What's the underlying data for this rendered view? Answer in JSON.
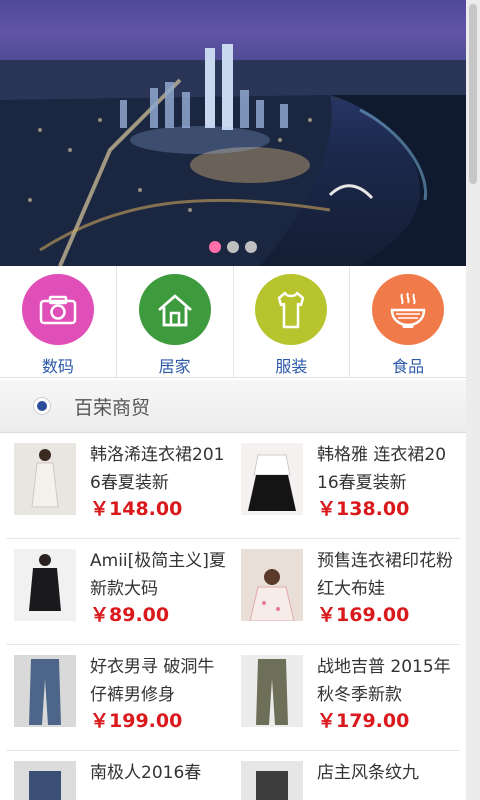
{
  "banner": {
    "slide_count": 3,
    "active_slide": 0
  },
  "categories": [
    {
      "label": "数码",
      "icon": "camera-icon",
      "color": "#e04fb8"
    },
    {
      "label": "居家",
      "icon": "home-icon",
      "color": "#3d9a3d"
    },
    {
      "label": "服装",
      "icon": "shirt-icon",
      "color": "#b7c42e"
    },
    {
      "label": "食品",
      "icon": "food-bowl-icon",
      "color": "#f07a4a"
    }
  ],
  "section": {
    "title": "百荣商贸"
  },
  "products": [
    {
      "title": "韩洛浠连衣裙2016春夏装新",
      "price": "￥148.00"
    },
    {
      "title": "韩格雅 连衣裙2016春夏装新",
      "price": "￥138.00"
    },
    {
      "title": "Amii[极简主义]夏新款大码",
      "price": "￥89.00"
    },
    {
      "title": "预售连衣裙印花粉红大布娃",
      "price": "￥169.00"
    },
    {
      "title": "好衣男寻 破洞牛仔裤男修身",
      "price": "￥199.00"
    },
    {
      "title": "战地吉普 2015年秋冬季新款",
      "price": "￥179.00"
    },
    {
      "title": "南极人2016春",
      "price": ""
    },
    {
      "title": "店主风条纹九",
      "price": ""
    }
  ],
  "colors": {
    "accent_blue": "#2d5aa8",
    "price_red": "#d9191c",
    "dot_active": "#ff6fa8"
  }
}
